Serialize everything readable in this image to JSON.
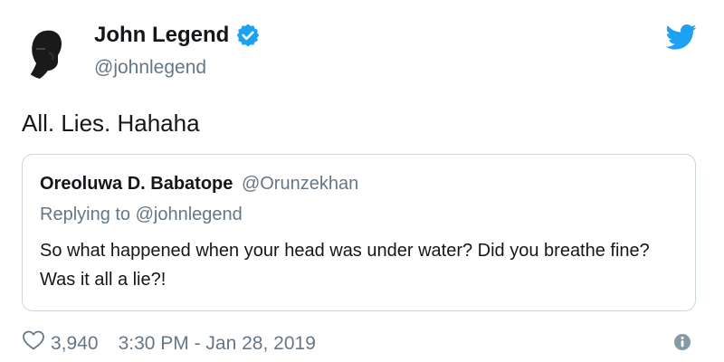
{
  "author": {
    "name": "John Legend",
    "handle": "@johnlegend",
    "verified": true,
    "avatar_icon": "profile-photo"
  },
  "tweet": {
    "text": "All. Lies. Hahaha"
  },
  "quoted_tweet": {
    "author_name": "Oreoluwa D. Babatope",
    "author_handle": "@Orunzekhan",
    "reply_context": "Replying to @johnlegend",
    "text": "So what happened when your head was under water? Did you breathe fine? Was it all a lie?!"
  },
  "footer": {
    "likes": "3,940",
    "timestamp": "3:30 PM - Jan 28, 2019",
    "like_icon": "heart-icon",
    "info_icon": "info-icon"
  },
  "brand": {
    "logo_icon": "twitter-bird-icon",
    "accent_color": "#1da1f2",
    "secondary_text_color": "#657786",
    "border_color": "#ccd6dd"
  }
}
